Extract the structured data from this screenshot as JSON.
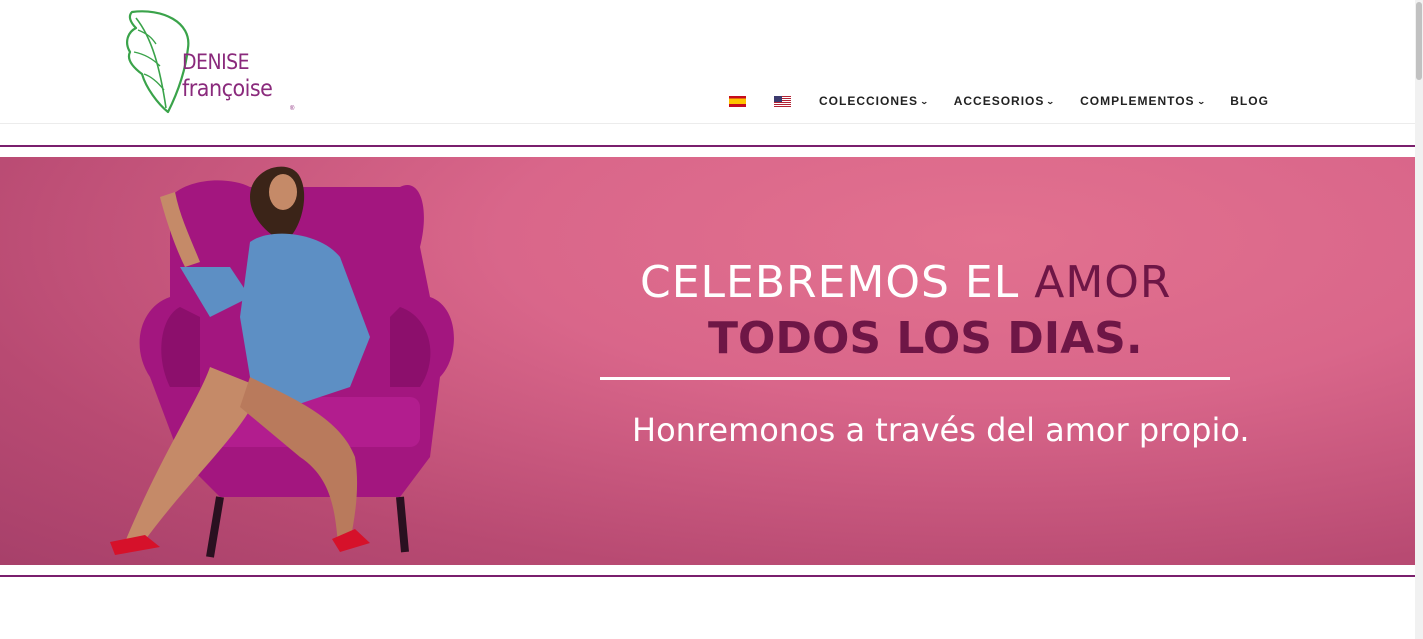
{
  "logo": {
    "line1": "DENISE",
    "line2": "françoise",
    "registered": "®"
  },
  "nav": {
    "flags": [
      {
        "name": "spain-flag-icon",
        "label": "Español"
      },
      {
        "name": "usa-flag-icon",
        "label": "English"
      }
    ],
    "items": [
      {
        "label": "COLECCIONES",
        "has_dropdown": true
      },
      {
        "label": "ACCESORIOS",
        "has_dropdown": true
      },
      {
        "label": "COMPLEMENTOS",
        "has_dropdown": true
      },
      {
        "label": "BLOG",
        "has_dropdown": false
      }
    ],
    "chevron": "❯"
  },
  "banner": {
    "headline_white": "CELEBREMOS EL ",
    "headline_accent": "AMOR",
    "headline_line2": "TODOS LOS DIAS.",
    "subline": "Honremonos a través del amor propio."
  },
  "colors": {
    "brand_purple": "#7a1f6d",
    "banner_pink": "#d9668a",
    "accent_wine": "#6e1646",
    "leaf_green": "#3aa34a"
  }
}
